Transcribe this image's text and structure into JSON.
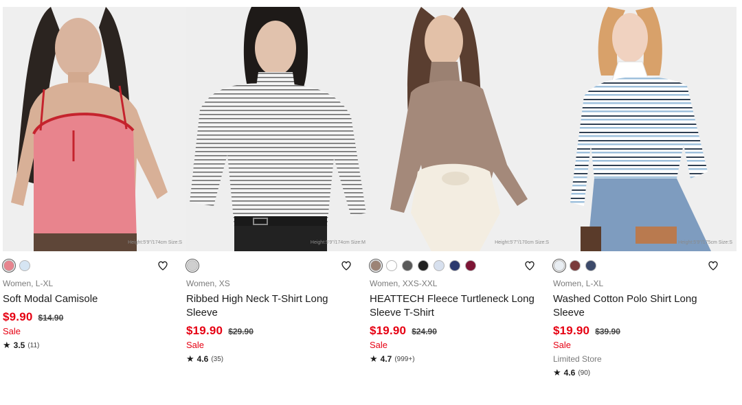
{
  "products": [
    {
      "photo_note": "Height:5'9\"/174cm Size:S",
      "swatches": [
        "#e7848e",
        "#d6e5f3"
      ],
      "meta": "Women, L-XL",
      "name": "Soft Modal Camisole",
      "price": "$9.90",
      "old_price": "$14.90",
      "sale": "Sale",
      "store": "",
      "rating": "3.5",
      "reviews": "(11)"
    },
    {
      "photo_note": "Height:5'9\"/174cm Size:M",
      "swatches": [
        "#cfcfcf"
      ],
      "meta": "Women, XS",
      "name": "Ribbed High Neck T-Shirt Long Sleeve",
      "price": "$19.90",
      "old_price": "$29.90",
      "sale": "Sale",
      "store": "",
      "rating": "4.6",
      "reviews": "(35)"
    },
    {
      "photo_note": "Height:5'7\"/170cm Size:S",
      "swatches": [
        "#9c8476",
        "#ffffff",
        "#5a5a5a",
        "#222222",
        "#d7e0ee",
        "#2c3a6e",
        "#7d1535"
      ],
      "meta": "Women, XXS-XXL",
      "name": "HEATTECH Fleece Turtleneck Long Sleeve T-Shirt",
      "price": "$19.90",
      "old_price": "$24.90",
      "sale": "Sale",
      "store": "",
      "rating": "4.7",
      "reviews": "(999+)"
    },
    {
      "photo_note": "Height:5'9\"/175cm Size:S",
      "swatches": [
        "#e9eef3",
        "#7a3b3b",
        "#3c4a6a"
      ],
      "meta": "Women, L-XL",
      "name": "Washed Cotton Polo Shirt Long Sleeve",
      "price": "$19.90",
      "old_price": "$39.90",
      "sale": "Sale",
      "store": "Limited Store",
      "rating": "4.6",
      "reviews": "(90)"
    }
  ],
  "icons": {
    "heart": "heart-outline-icon",
    "star": "star-icon"
  },
  "colors": {
    "sale_red": "#e60012",
    "text": "#1b1b1b",
    "muted": "#7a7a7a"
  }
}
